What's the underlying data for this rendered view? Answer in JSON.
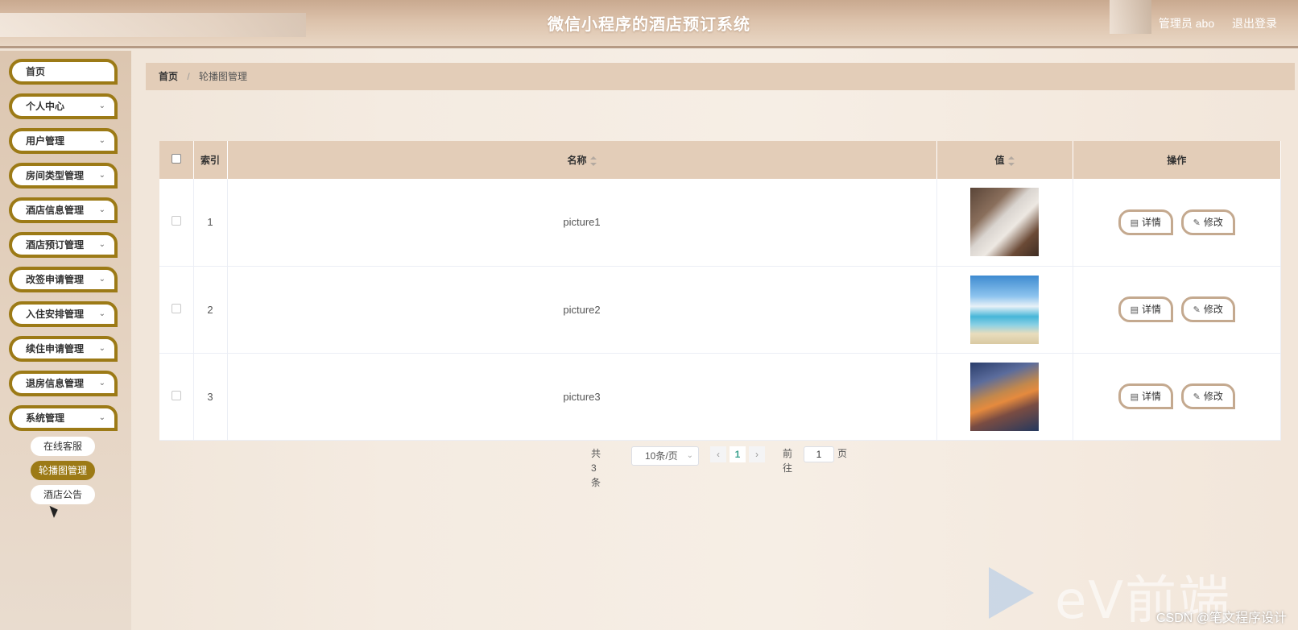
{
  "header": {
    "title": "微信小程序的酒店预订系统",
    "user_label": "管理员 abo",
    "logout_label": "退出登录"
  },
  "sidebar": {
    "items": [
      {
        "label": "首页"
      },
      {
        "label": "个人中心"
      },
      {
        "label": "用户管理"
      },
      {
        "label": "房间类型管理"
      },
      {
        "label": "酒店信息管理"
      },
      {
        "label": "酒店预订管理"
      },
      {
        "label": "改签申请管理"
      },
      {
        "label": "入住安排管理"
      },
      {
        "label": "续住申请管理"
      },
      {
        "label": "退房信息管理"
      },
      {
        "label": "系统管理"
      }
    ],
    "sub_items": [
      {
        "label": "在线客服"
      },
      {
        "label": "轮播图管理"
      },
      {
        "label": "酒店公告"
      }
    ]
  },
  "breadcrumb": {
    "home": "首页",
    "separator": "/",
    "current": "轮播图管理"
  },
  "table": {
    "columns": [
      "索引",
      "名称",
      "值",
      "操作"
    ],
    "rows": [
      {
        "index": "1",
        "name": "picture1"
      },
      {
        "index": "2",
        "name": "picture2"
      },
      {
        "index": "3",
        "name": "picture3"
      }
    ],
    "detail_label": "详情",
    "edit_label": "修改"
  },
  "pagination": {
    "total": "共 3 条",
    "page_size": "10条/页",
    "current_page": "1",
    "goto_prefix": "前往",
    "goto_value": "1",
    "goto_suffix": "页"
  },
  "watermark": {
    "brand": "eV前端",
    "csdn": "CSDN @笔文程序设计"
  },
  "colors": {
    "accent": "#9c7a16",
    "header_bg": "#dcc2ab",
    "table_head": "#e3cdb8"
  }
}
